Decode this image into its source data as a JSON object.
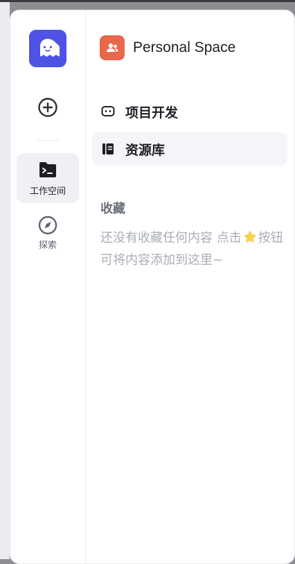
{
  "sidebar": {
    "items": [
      {
        "label": "工作空间",
        "icon": "terminal-folder-icon",
        "active": true
      },
      {
        "label": "探索",
        "icon": "compass-icon",
        "active": false
      }
    ]
  },
  "space": {
    "name": "Personal Space",
    "avatar_color": "#e8684a"
  },
  "menu": [
    {
      "label": "项目开发",
      "icon": "bot-icon",
      "active": false
    },
    {
      "label": "资源库",
      "icon": "library-icon",
      "active": true
    }
  ],
  "favorites": {
    "title": "收藏",
    "empty_before": "还没有收藏任何内容 点击",
    "empty_after": "按钮可将内容添加到这里~"
  },
  "colors": {
    "logo": "#4f52e6",
    "active_bg": "#f4f5f8",
    "text": "#1d1f24",
    "muted": "#a9adb6"
  }
}
